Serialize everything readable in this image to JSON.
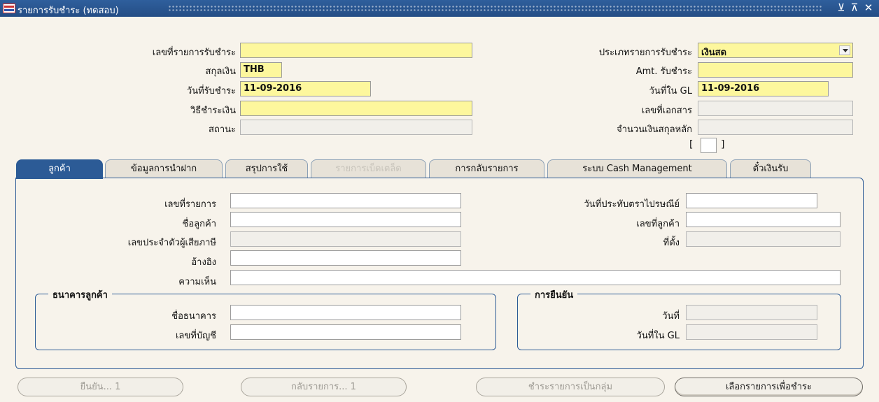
{
  "window": {
    "title": "รายการรับชำระ (ทดสอบ)",
    "minimize_glyph": "⊻",
    "maximize_glyph": "⊼",
    "close_glyph": "✕"
  },
  "header": {
    "receipt_number": {
      "label": "เลขที่รายการรับชำระ",
      "value": ""
    },
    "currency": {
      "label": "สกุลเงิน",
      "value": "THB"
    },
    "receipt_date": {
      "label": "วันที่รับชำระ",
      "value": "11-09-2016"
    },
    "payment_method": {
      "label": "วิธีชำระเงิน",
      "value": ""
    },
    "status": {
      "label": "สถานะ",
      "value": ""
    },
    "receipt_type": {
      "label": "ประเภทรายการรับชำระ",
      "value": "เงินสด"
    },
    "amount": {
      "label": "Amt. รับชำระ",
      "value": ""
    },
    "gl_date": {
      "label": "วันที่ใน GL",
      "value": "11-09-2016"
    },
    "document_number": {
      "label": "เลขที่เอกสาร",
      "value": ""
    },
    "functional_amount": {
      "label": "จำนวนเงินสกุลหลัก",
      "value": ""
    },
    "bracket_open": "[",
    "bracket_close": "]"
  },
  "tabs": [
    {
      "label": "ลูกค้า",
      "state": "active"
    },
    {
      "label": "ข้อมูลการนำฝาก",
      "state": "normal"
    },
    {
      "label": "สรุปการใช้",
      "state": "normal"
    },
    {
      "label": "รายการเบ็ดเตล็ด",
      "state": "disabled"
    },
    {
      "label": "การกลับรายการ",
      "state": "normal"
    },
    {
      "label": "ระบบ Cash Management",
      "state": "normal"
    },
    {
      "label": "ตั๋วเงินรับ",
      "state": "normal"
    }
  ],
  "customer": {
    "transaction_number": {
      "label": "เลขที่รายการ",
      "value": ""
    },
    "customer_name": {
      "label": "ชื่อลูกค้า",
      "value": ""
    },
    "taxpayer_id": {
      "label": "เลขประจำตัวผู้เสียภาษี",
      "value": ""
    },
    "reference": {
      "label": "อ้างอิง",
      "value": ""
    },
    "comments": {
      "label": "ความเห็น",
      "value": ""
    },
    "postmark_date": {
      "label": "วันที่ประทับตราไปรษณีย์",
      "value": ""
    },
    "customer_number": {
      "label": "เลขที่ลูกค้า",
      "value": ""
    },
    "location": {
      "label": "ที่ตั้ง",
      "value": ""
    }
  },
  "bank_group": {
    "title": "ธนาคารลูกค้า",
    "bank_name": {
      "label": "ชื่อธนาคาร",
      "value": ""
    },
    "account_number": {
      "label": "เลขที่บัญชี",
      "value": ""
    }
  },
  "confirm_group": {
    "title": "การยืนยัน",
    "date": {
      "label": "วันที่",
      "value": ""
    },
    "gl_date": {
      "label": "วันที่ใน GL",
      "value": ""
    }
  },
  "buttons": {
    "confirm": "ยืนยัน... 1",
    "reverse": "กลับรายการ... 1",
    "batch": "ชำระรายการเป็นกลุ่ม",
    "select": "เลือกรายการเพื่อชำระ"
  }
}
